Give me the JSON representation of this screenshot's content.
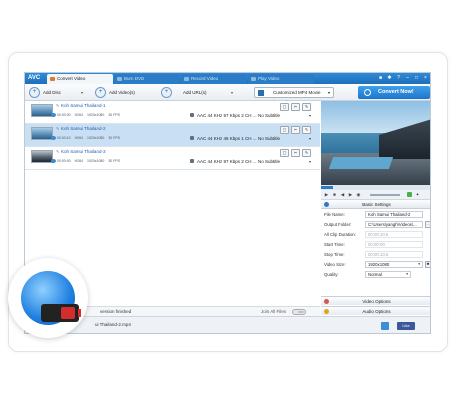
{
  "app": {
    "logo": "AVC",
    "tabs": [
      {
        "label": "Convert Video"
      },
      {
        "label": "Burn DVD"
      },
      {
        "label": "Record Video"
      },
      {
        "label": "Play Video"
      }
    ]
  },
  "toolbar": {
    "add_disc": "Add Disc",
    "add_videos": "Add Video(s)",
    "add_urls": "Add URL(s)",
    "profile": "Customized MP4 Movie (*.mp4)",
    "convert_now": "Convert Now!"
  },
  "files": [
    {
      "name": "Koh Samui Thailand-1",
      "duration": "00:00:00",
      "codec": "H264",
      "resolution": "1920x1080",
      "fps": "30 FPS",
      "audio": "AAC 44 KHz 97 Kbps 2 CH ...",
      "subtitle": "No Subtitle"
    },
    {
      "name": "Koh Samui Thailand-2",
      "duration": "00:00:10",
      "codec": "H264",
      "resolution": "1920x1080",
      "fps": "30 FPS",
      "audio": "AAC 44 KHz 46 Kbps 1 CH ...",
      "subtitle": "No Subtitle"
    },
    {
      "name": "Koh Samui Thailand-3",
      "duration": "00:00:00",
      "codec": "H264",
      "resolution": "1920x1080",
      "fps": "30 FPS",
      "audio": "AAC 44 KHz 97 Kbps 2 CH ...",
      "subtitle": "No Subtitle"
    }
  ],
  "status": {
    "message": "version finished",
    "join_all": "Join All Files",
    "toggle": "OFF",
    "output_path": "ui Thailand-2.mp4",
    "like": "Like"
  },
  "settings": {
    "header": "Basic Settings",
    "file_name_label": "File Name:",
    "file_name": "Koh Samui Thailand-2",
    "output_folder_label": "Output Folder:",
    "output_folder": "C:\\Users\\yangh\\Videos\\...",
    "all_clip_label": "All Clip Duration:",
    "all_clip": "00:00:10.5",
    "start_label": "Start Time:",
    "start": "00:00:00",
    "stop_label": "Stop Time:",
    "stop": "00:00:10.5",
    "video_size_label": "Video Size:",
    "video_size": "1920x1080",
    "quality_label": "Quality:",
    "quality": "Normal",
    "video_options": "Video Options",
    "audio_options": "Audio Options"
  },
  "colors": {
    "brand": "#1f6fb9",
    "selected_row": "#c9dff3",
    "convert_button": "#2a86d6"
  }
}
